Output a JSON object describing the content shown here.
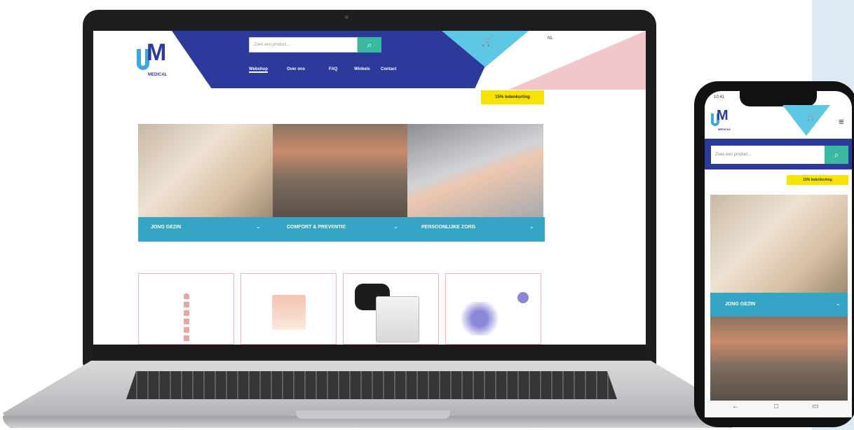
{
  "laptop": {
    "logo": {
      "letter": "M",
      "wordmark": "MEDICAL"
    },
    "search": {
      "placeholder": "Zoek een product...",
      "button_icon": "search-icon"
    },
    "nav": [
      "Webshop",
      "Over ons",
      "FAQ",
      "Winkels",
      "Contact"
    ],
    "active_nav": "Webshop",
    "cart_icon": "cart-icon",
    "language": "NL",
    "promo": "15% ledenkorting",
    "categories": [
      {
        "label": "JONG GEZIN",
        "chevron": "⌄"
      },
      {
        "label": "COMFORT & PREVENTIE",
        "chevron": "⌄"
      },
      {
        "label": "PERSOONLIJKE ZORG",
        "chevron": "⌄"
      }
    ],
    "products": [
      {
        "name": "pacifier-clip"
      },
      {
        "name": "baby-product-box"
      },
      {
        "name": "blood-pressure-monitor"
      },
      {
        "name": "breast-pump"
      }
    ],
    "colors": {
      "primary": "#2b3a9b",
      "accent": "#36a4c4",
      "promo": "#f7e300",
      "pink": "#f2c6cb",
      "cyan": "#5ec8e4",
      "search_button": "#3bb8a0"
    }
  },
  "phone": {
    "time": "10:41",
    "search": {
      "placeholder": "Zoek een product...",
      "button_icon": "search-icon"
    },
    "menu_icon": "hamburger-icon",
    "cart_icon": "cart-icon",
    "promo": "15% ledenkorting",
    "category": {
      "label": "JONG GEZIN",
      "chevron": "⌄"
    },
    "nav_buttons": [
      "←",
      "□",
      "▭"
    ]
  }
}
